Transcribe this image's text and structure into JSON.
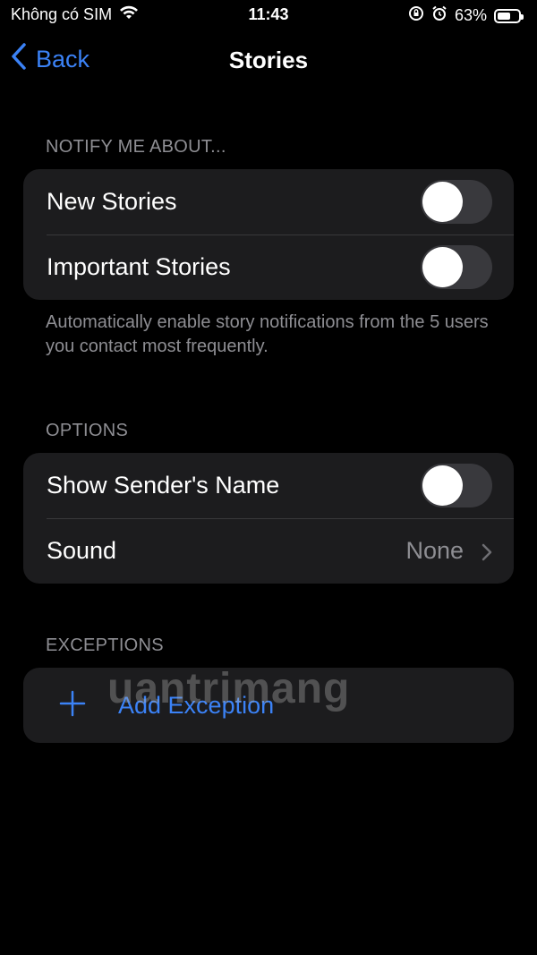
{
  "status_bar": {
    "carrier": "Không có SIM",
    "time": "11:43",
    "battery_percent": "63%",
    "battery_level": 0.63
  },
  "nav": {
    "back_label": "Back",
    "title": "Stories"
  },
  "sections": {
    "notify": {
      "header": "NOTIFY ME ABOUT...",
      "rows": [
        {
          "label": "New Stories",
          "toggle_on": false
        },
        {
          "label": "Important Stories",
          "toggle_on": false
        }
      ],
      "footer": "Automatically enable story notifications from the 5 users you contact most frequently."
    },
    "options": {
      "header": "OPTIONS",
      "rows": [
        {
          "label": "Show Sender's Name",
          "toggle_on": false
        },
        {
          "label": "Sound",
          "value": "None"
        }
      ]
    },
    "exceptions": {
      "header": "EXCEPTIONS",
      "add_label": "Add Exception"
    }
  },
  "watermark": "uantrimang",
  "colors": {
    "accent": "#3b82f6",
    "background": "#000000",
    "cell": "#1c1c1e",
    "secondary_text": "#8e8e93",
    "toggle_off": "#39393d"
  }
}
